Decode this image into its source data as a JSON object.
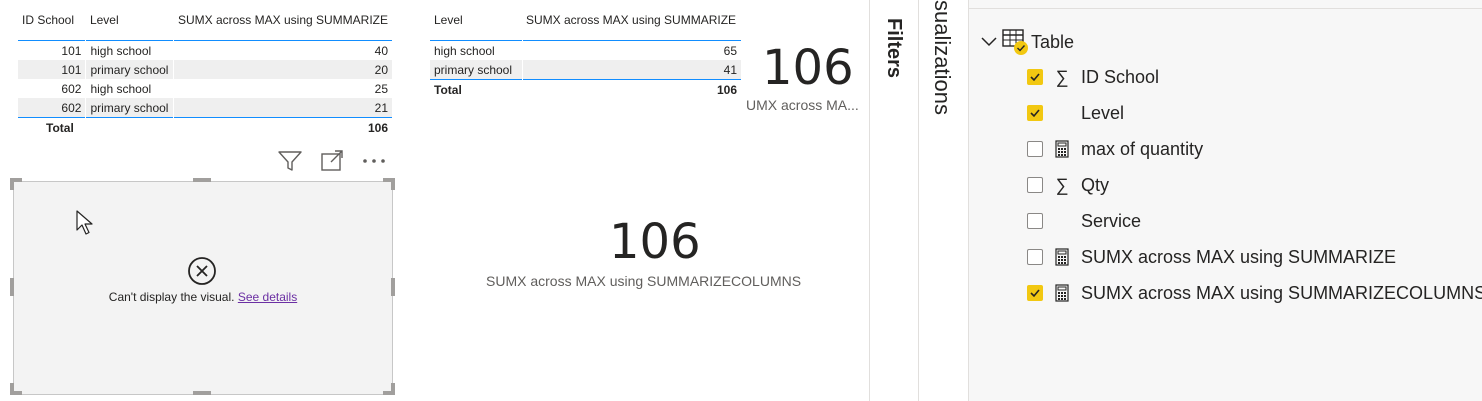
{
  "table1": {
    "headers": [
      "ID School",
      "Level",
      "SUMX across MAX using SUMMARIZE"
    ],
    "rows": [
      [
        "101",
        "high school",
        "40"
      ],
      [
        "101",
        "primary school",
        "20"
      ],
      [
        "602",
        "high school",
        "25"
      ],
      [
        "602",
        "primary school",
        "21"
      ]
    ],
    "total_label": "Total",
    "total_value": "106"
  },
  "table2": {
    "headers": [
      "Level",
      "SUMX across MAX using SUMMARIZE"
    ],
    "rows": [
      [
        "high school",
        "65"
      ],
      [
        "primary school",
        "41"
      ]
    ],
    "total_label": "Total",
    "total_value": "106"
  },
  "card1": {
    "value": "106",
    "label": "UMX across MA..."
  },
  "card2": {
    "value": "106",
    "label": "SUMX across MAX using SUMMARIZECOLUMNS"
  },
  "error_visual": {
    "message": "Can't display the visual.",
    "link": "See details"
  },
  "filters_pane": {
    "label": "Filters"
  },
  "visualizations_pane": {
    "label": "sualizations"
  },
  "fields": {
    "table_name": "Table",
    "items": [
      {
        "label": "ID School",
        "checked": true,
        "icon": "sigma-icon"
      },
      {
        "label": "Level",
        "checked": true,
        "icon": ""
      },
      {
        "label": "max of quantity",
        "checked": false,
        "icon": "calculator-icon"
      },
      {
        "label": "Qty",
        "checked": false,
        "icon": "sigma-icon"
      },
      {
        "label": "Service",
        "checked": false,
        "icon": ""
      },
      {
        "label": "SUMX across MAX using SUMMARIZE",
        "checked": false,
        "icon": "calculator-icon"
      },
      {
        "label": "SUMX across MAX using SUMMARIZECOLUMNS",
        "checked": true,
        "icon": "calculator-icon"
      }
    ]
  },
  "colors": {
    "accent": "#118dff",
    "check": "#f2c811",
    "link": "#6b2fa3"
  }
}
